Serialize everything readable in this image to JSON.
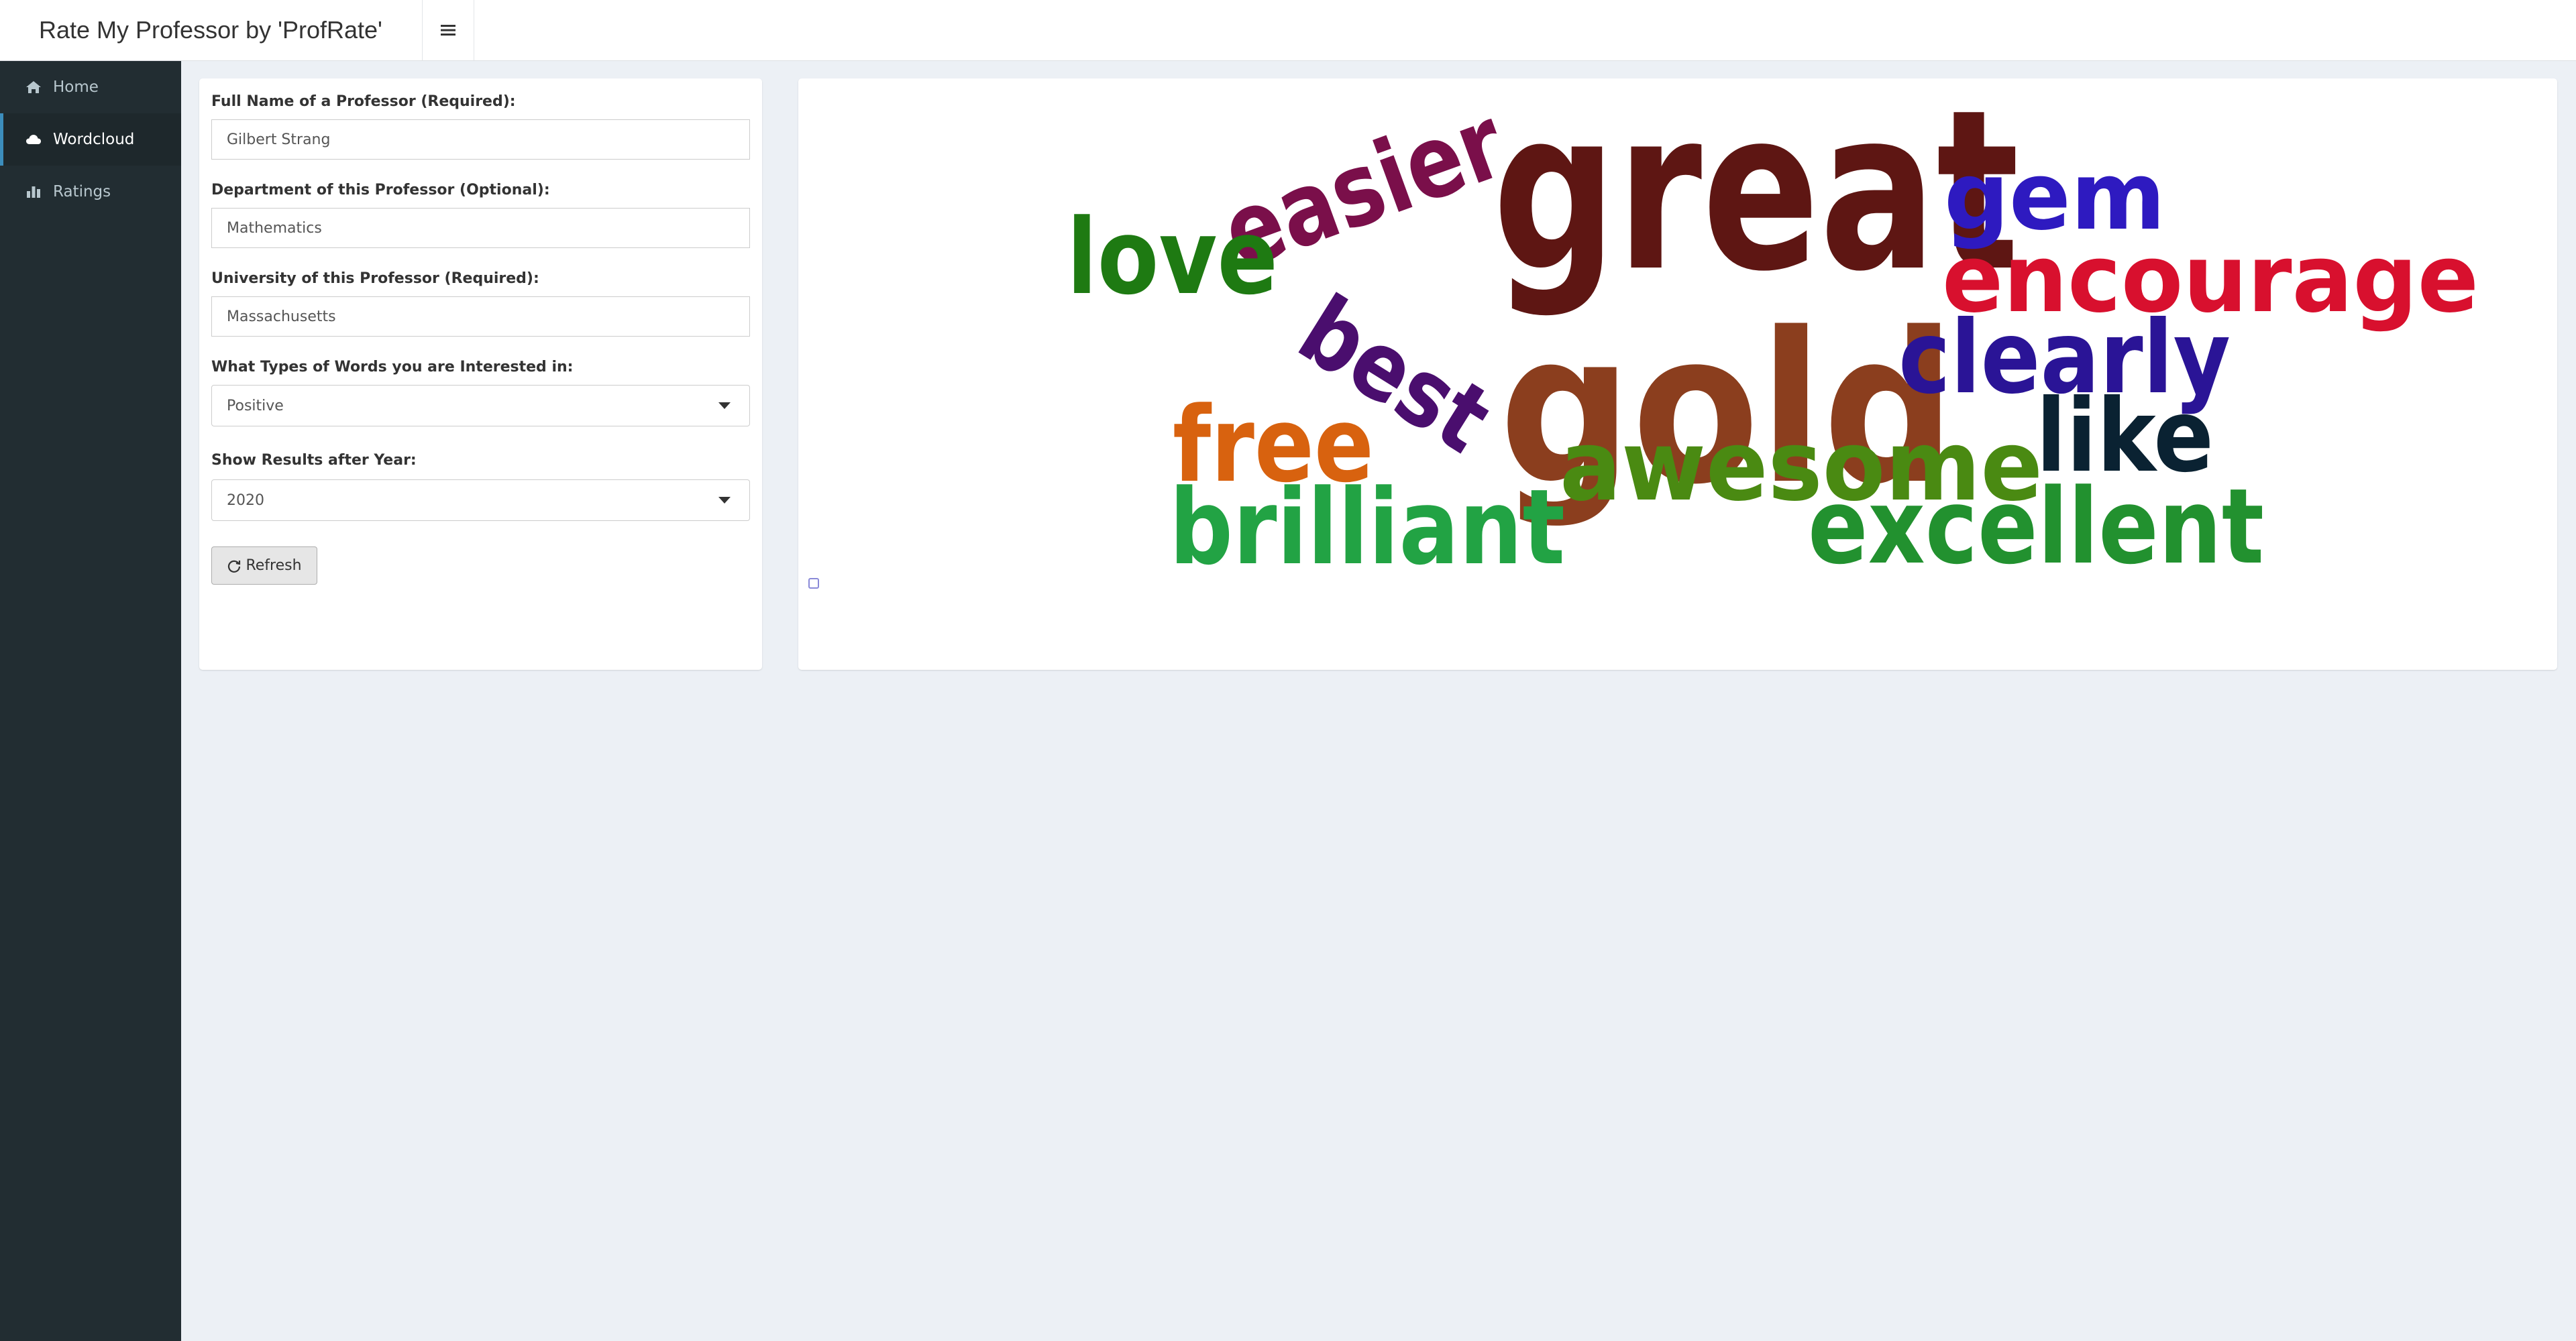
{
  "header": {
    "title": "Rate My Professor by 'ProfRate'",
    "toggle_icon": "hamburger-icon"
  },
  "sidebar": {
    "items": [
      {
        "label": "Home",
        "icon": "home-icon",
        "active": false
      },
      {
        "label": "Wordcloud",
        "icon": "cloud-icon",
        "active": true
      },
      {
        "label": "Ratings",
        "icon": "bar-chart-icon",
        "active": false
      }
    ]
  },
  "form": {
    "name_label": "Full Name of a Professor (Required):",
    "name_value": "Gilbert Strang",
    "dept_label": "Department of this Professor (Optional):",
    "dept_value": "Mathematics",
    "univ_label": "University of this Professor (Required):",
    "univ_value": "Massachusetts",
    "word_type_label": "What Types of Words you are Interested in:",
    "word_type_value": "Positive",
    "year_label": "Show Results after Year:",
    "year_value": "2020",
    "refresh_label": "Refresh"
  },
  "wordcloud": {
    "words": [
      {
        "text": "great",
        "color": "#5e1613"
      },
      {
        "text": "gold",
        "color": "#8b3e1e"
      },
      {
        "text": "easier",
        "color": "#7a0f4a"
      },
      {
        "text": "love",
        "color": "#1e7a12"
      },
      {
        "text": "best",
        "color": "#4a0e6e"
      },
      {
        "text": "free",
        "color": "#d8620f"
      },
      {
        "text": "brilliant",
        "color": "#22a344"
      },
      {
        "text": "awesome",
        "color": "#4a8a12"
      },
      {
        "text": "excellent",
        "color": "#22912f"
      },
      {
        "text": "gem",
        "color": "#2e1ac0"
      },
      {
        "text": "encourage",
        "color": "#d8102e"
      },
      {
        "text": "clearly",
        "color": "#2a1496"
      },
      {
        "text": "like",
        "color": "#0a2232"
      }
    ]
  }
}
